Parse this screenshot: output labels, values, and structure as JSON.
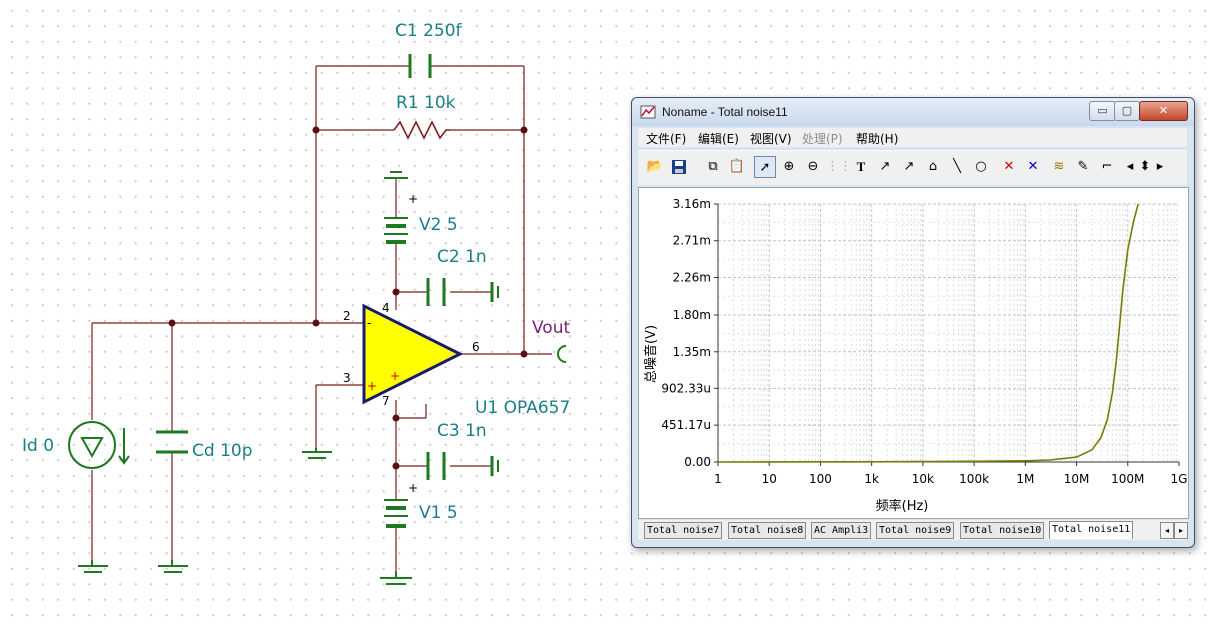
{
  "schematic": {
    "labels": {
      "c1": "C1 250f",
      "r1": "R1 10k",
      "v2": "V2 5",
      "c2": "C2 1n",
      "vout": "Vout",
      "u1": "U1 OPA657",
      "c3": "C3 1n",
      "v1": "V1 5",
      "id0": "Id 0",
      "cd": "Cd 10p"
    },
    "pins": {
      "p2": "2",
      "p3": "3",
      "p4": "4",
      "p6": "6",
      "p7": "7"
    },
    "plus_signs": {
      "v2": "+",
      "v1": "+"
    },
    "colors": {
      "wire": "#7a1f1f",
      "component": "#1e7a1e",
      "opamp_fill": "#ffff00",
      "opamp_border": "#1a1a6e",
      "label": "#1a7f86",
      "vout": "#7a1f7a"
    }
  },
  "window": {
    "title": "Noname - Total noise11",
    "buttons": {
      "minimize": "▭",
      "maximize": "▢",
      "close": "✕"
    },
    "menu": [
      {
        "label": "文件(F)",
        "enabled": true
      },
      {
        "label": "编辑(E)",
        "enabled": true
      },
      {
        "label": "视图(V)",
        "enabled": true
      },
      {
        "label": "处理(P)",
        "enabled": false
      },
      {
        "label": "帮助(H)",
        "enabled": true
      }
    ],
    "toolbar": [
      {
        "name": "open-icon"
      },
      {
        "name": "save-icon"
      },
      {
        "name": "copy-icon"
      },
      {
        "name": "paste-icon"
      },
      {
        "name": "pointer-icon"
      },
      {
        "name": "zoom-in-icon"
      },
      {
        "name": "zoom-100-icon"
      },
      {
        "name": "grid-icon"
      },
      {
        "name": "text-icon"
      },
      {
        "name": "curve-label-icon"
      },
      {
        "name": "curve-label-2-icon"
      },
      {
        "name": "axis-label-icon"
      },
      {
        "name": "line-icon"
      },
      {
        "name": "ellipse-icon"
      },
      {
        "name": "cursor-a-icon"
      },
      {
        "name": "cursor-b-icon"
      },
      {
        "name": "curves-icon"
      },
      {
        "name": "probe-icon"
      },
      {
        "name": "step-icon"
      },
      {
        "name": "scroll-left-icon"
      },
      {
        "name": "scroll-updown-icon"
      },
      {
        "name": "scroll-right-icon"
      }
    ],
    "tabs": [
      {
        "label": "Total noise7",
        "active": false
      },
      {
        "label": "Total noise8",
        "active": false
      },
      {
        "label": "AC Ampli3",
        "active": false
      },
      {
        "label": "Total noise9",
        "active": false
      },
      {
        "label": "Total noise10",
        "active": false
      },
      {
        "label": "Total noise11",
        "active": true
      }
    ],
    "tab_scroll": {
      "left": "◂",
      "right": "▸"
    }
  },
  "chart_data": {
    "type": "line",
    "xlabel": "频率(Hz)",
    "ylabel": "总噪音(V)",
    "x_scale": "log",
    "xlim": [
      1,
      1000000000
    ],
    "x_ticks": [
      1,
      10,
      100,
      1000,
      10000,
      100000,
      1000000,
      10000000,
      100000000,
      1000000000
    ],
    "x_tick_labels": [
      "1",
      "10",
      "100",
      "1k",
      "10k",
      "100k",
      "1M",
      "10M",
      "100M",
      "1G"
    ],
    "ylim": [
      0,
      0.00316
    ],
    "y_ticks": [
      0,
      0.00045117,
      0.00090232,
      0.00135,
      0.0018,
      0.00226,
      0.00271,
      0.00316
    ],
    "y_tick_labels": [
      "0.00",
      "451.17u",
      "902.33u",
      "1.35m",
      "1.80m",
      "2.26m",
      "2.71m",
      "3.16m"
    ],
    "grid": true,
    "series": [
      {
        "color": "#7a7a00",
        "x": [
          1,
          10,
          100,
          1000,
          10000,
          100000,
          1000000,
          3000000,
          10000000,
          20000000,
          30000000,
          40000000,
          50000000,
          60000000,
          70000000,
          80000000,
          100000000,
          130000000,
          160000000
        ],
        "y": [
          0,
          1e-06,
          2e-06,
          3e-06,
          5e-06,
          8e-06,
          1.5e-05,
          2.5e-05,
          6e-05,
          0.00015,
          0.0003,
          0.00052,
          0.00085,
          0.00125,
          0.0017,
          0.0021,
          0.0026,
          0.00295,
          0.00316
        ]
      }
    ]
  }
}
